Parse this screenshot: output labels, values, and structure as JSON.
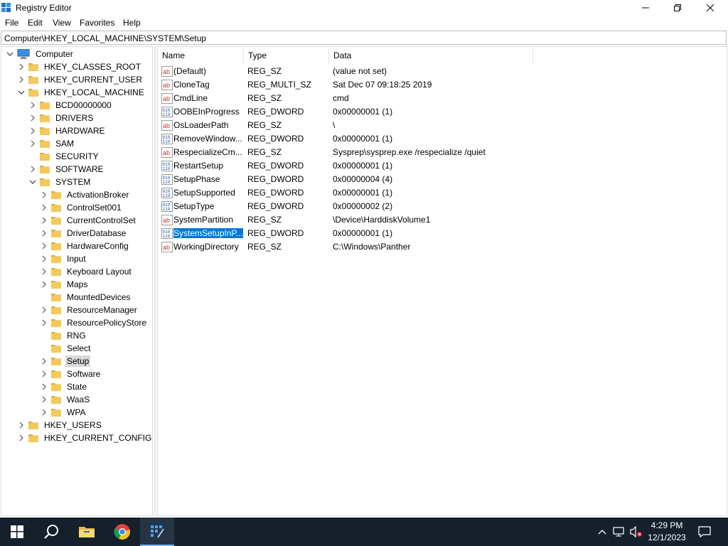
{
  "window": {
    "title": "Registry Editor",
    "minimize_glyph": "—",
    "maximize_glyph": "❐",
    "close_glyph": "✕"
  },
  "menu": [
    "File",
    "Edit",
    "View",
    "Favorites",
    "Help"
  ],
  "address": "Computer\\HKEY_LOCAL_MACHINE\\SYSTEM\\Setup",
  "tree": {
    "root": "Computer",
    "hives": [
      "HKEY_CLASSES_ROOT",
      "HKEY_CURRENT_USER",
      "HKEY_LOCAL_MACHINE",
      "HKEY_USERS",
      "HKEY_CURRENT_CONFIG"
    ],
    "hklm_children": [
      "BCD00000000",
      "DRIVERS",
      "HARDWARE",
      "SAM",
      "SECURITY",
      "SOFTWARE",
      "SYSTEM"
    ],
    "system_children": [
      "ActivationBroker",
      "ControlSet001",
      "CurrentControlSet",
      "DriverDatabase",
      "HardwareConfig",
      "Input",
      "Keyboard Layout",
      "Maps",
      "MountedDevices",
      "ResourceManager",
      "ResourcePolicyStore",
      "RNG",
      "Select",
      "Setup",
      "Software",
      "State",
      "WaaS",
      "WPA"
    ],
    "selected": "Setup"
  },
  "columns": {
    "name": "Name",
    "type": "Type",
    "data": "Data"
  },
  "values": [
    {
      "name": "(Default)",
      "type": "REG_SZ",
      "data": "(value not set)",
      "icon": "string-value-icon"
    },
    {
      "name": "CloneTag",
      "type": "REG_MULTI_SZ",
      "data": "Sat Dec 07 09:18:25 2019",
      "icon": "string-value-icon"
    },
    {
      "name": "CmdLine",
      "type": "REG_SZ",
      "data": "cmd",
      "icon": "string-value-icon"
    },
    {
      "name": "OOBEInProgress",
      "type": "REG_DWORD",
      "data": "0x00000001 (1)",
      "icon": "binary-value-icon"
    },
    {
      "name": "OsLoaderPath",
      "type": "REG_SZ",
      "data": "\\",
      "icon": "string-value-icon"
    },
    {
      "name": "RemoveWindow...",
      "type": "REG_DWORD",
      "data": "0x00000001 (1)",
      "icon": "binary-value-icon"
    },
    {
      "name": "RespecializeCm...",
      "type": "REG_SZ",
      "data": "Sysprep\\sysprep.exe /respecialize /quiet",
      "icon": "string-value-icon"
    },
    {
      "name": "RestartSetup",
      "type": "REG_DWORD",
      "data": "0x00000001 (1)",
      "icon": "binary-value-icon"
    },
    {
      "name": "SetupPhase",
      "type": "REG_DWORD",
      "data": "0x00000004 (4)",
      "icon": "binary-value-icon"
    },
    {
      "name": "SetupSupported",
      "type": "REG_DWORD",
      "data": "0x00000001 (1)",
      "icon": "binary-value-icon"
    },
    {
      "name": "SetupType",
      "type": "REG_DWORD",
      "data": "0x00000002 (2)",
      "icon": "binary-value-icon"
    },
    {
      "name": "SystemPartition",
      "type": "REG_SZ",
      "data": "\\Device\\HarddiskVolume1",
      "icon": "string-value-icon"
    },
    {
      "name": "SystemSetupInP...",
      "type": "REG_DWORD",
      "data": "0x00000001 (1)",
      "icon": "binary-value-icon",
      "selected": true
    },
    {
      "name": "WorkingDirectory",
      "type": "REG_SZ",
      "data": "C:\\Windows\\Panther",
      "icon": "string-value-icon"
    }
  ],
  "taskbar": {
    "time": "4:29 PM",
    "date": "12/1/2023",
    "apps": [
      "start-icon",
      "search-icon",
      "file-explorer-icon",
      "chrome-icon",
      "regedit-icon"
    ],
    "tray": [
      "chevron-up-icon",
      "network-icon",
      "volume-muted-icon",
      "notifications-icon"
    ]
  },
  "colors": {
    "taskbar_bg": "#16202c",
    "selection": "#0078d7",
    "folder": "#f3c95c"
  }
}
